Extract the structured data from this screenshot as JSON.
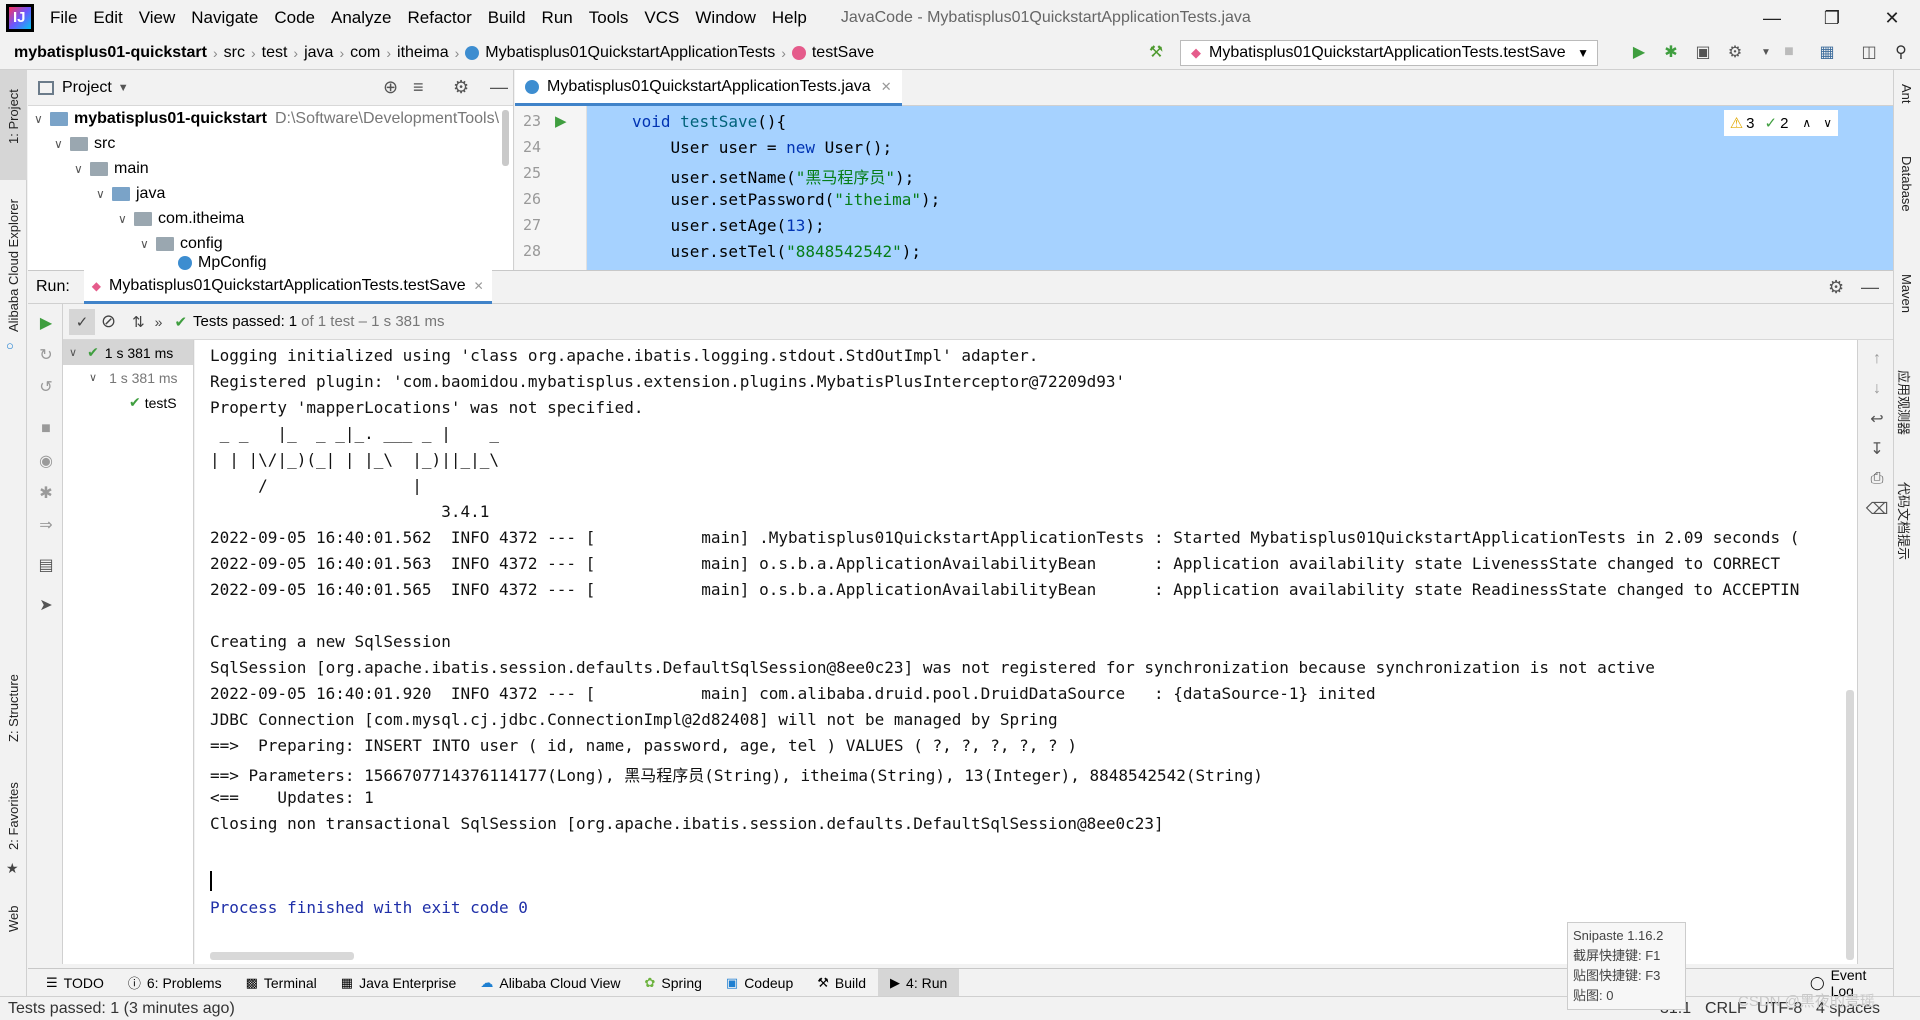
{
  "menubar": {
    "items": [
      "File",
      "Edit",
      "View",
      "Navigate",
      "Code",
      "Analyze",
      "Refactor",
      "Build",
      "Run",
      "Tools",
      "VCS",
      "Window",
      "Help"
    ],
    "title": "JavaCode - Mybatisplus01QuickstartApplicationTests.java"
  },
  "breadcrumb": {
    "items": [
      "mybatisplus01-quickstart",
      "src",
      "test",
      "java",
      "com",
      "itheima",
      "Mybatisplus01QuickstartApplicationTests",
      "testSave"
    ]
  },
  "run_config": "Mybatisplus01QuickstartApplicationTests.testSave",
  "left_strip": {
    "project": "1: Project",
    "alibaba": "Alibaba Cloud Explorer",
    "structure": "Z: Structure",
    "favorites": "2: Favorites",
    "web": "Web"
  },
  "right_strip": {
    "ant": "Ant",
    "database": "Database",
    "maven": "Maven",
    "plugin1": "应用观测器",
    "plugin2": "代码文档提示"
  },
  "project_panel": {
    "title": "Project",
    "root_name": "mybatisplus01-quickstart",
    "root_path": "D:\\Software\\DevelopmentTools\\",
    "tree": [
      "src",
      "main",
      "java",
      "com.itheima",
      "config",
      "MpConfig"
    ]
  },
  "editor": {
    "tab": "Mybatisplus01QuickstartApplicationTests.java",
    "inspect_warnings": "3",
    "inspect_ok": "2",
    "lines": [
      {
        "num": "23",
        "kw": "void ",
        "fn": "testSave",
        "rest": "(){"
      },
      {
        "num": "24",
        "pre": "    User user = ",
        "kw": "new ",
        "rest": "User();"
      },
      {
        "num": "25",
        "pre": "    user.setName(",
        "str": "\"黑马程序员\"",
        "rest": ");"
      },
      {
        "num": "26",
        "pre": "    user.setPassword(",
        "str": "\"itheima\"",
        "rest": ");"
      },
      {
        "num": "27",
        "pre": "    user.setAge(",
        "num_lit": "13",
        "rest": ");"
      },
      {
        "num": "28",
        "pre": "    user.setTel(",
        "str": "\"8848542542\"",
        "rest": ");"
      }
    ]
  },
  "run_panel": {
    "label": "Run:",
    "tab": "Mybatisplus01QuickstartApplicationTests.testSave",
    "status_bold": "Tests passed:",
    "status_count": "1",
    "status_rest": "of 1 test – 1 s 381 ms",
    "tree": [
      {
        "label": "1 s 381 ms"
      },
      {
        "label": "1 s 381 ms"
      },
      {
        "label": "testS"
      }
    ]
  },
  "console": {
    "lines": [
      "Logging initialized using 'class org.apache.ibatis.logging.stdout.StdOutImpl' adapter.",
      "Registered plugin: 'com.baomidou.mybatisplus.extension.plugins.MybatisPlusInterceptor@72209d93'",
      "Property 'mapperLocations' was not specified.",
      " _ _   |_  _ _|_. ___ _ |    _",
      "| | |\\/|_)(_| | |_\\  |_)||_|_\\",
      "     /               |",
      "                        3.4.1",
      "2022-09-05 16:40:01.562  INFO 4372 --- [           main] .Mybatisplus01QuickstartApplicationTests : Started Mybatisplus01QuickstartApplicationTests in 2.09 seconds (",
      "2022-09-05 16:40:01.563  INFO 4372 --- [           main] o.s.b.a.ApplicationAvailabilityBean      : Application availability state LivenessState changed to CORRECT",
      "2022-09-05 16:40:01.565  INFO 4372 --- [           main] o.s.b.a.ApplicationAvailabilityBean      : Application availability state ReadinessState changed to ACCEPTIN",
      "",
      "Creating a new SqlSession",
      "SqlSession [org.apache.ibatis.session.defaults.DefaultSqlSession@8ee0c23] was not registered for synchronization because synchronization is not active",
      "2022-09-05 16:40:01.920  INFO 4372 --- [           main] com.alibaba.druid.pool.DruidDataSource   : {dataSource-1} inited",
      "JDBC Connection [com.mysql.cj.jdbc.ConnectionImpl@2d82408] will not be managed by Spring",
      "==>  Preparing: INSERT INTO user ( id, name, password, age, tel ) VALUES ( ?, ?, ?, ?, ? )",
      "==> Parameters: 1566707714376114177(Long), 黑马程序员(String), itheima(String), 13(Integer), 8848542542(String)",
      "<==    Updates: 1",
      "Closing non transactional SqlSession [org.apache.ibatis.session.defaults.DefaultSqlSession@8ee0c23]",
      "",
      "",
      "Process finished with exit code 0"
    ]
  },
  "bottom_tools": [
    {
      "icon": "list-icon",
      "label": "TODO"
    },
    {
      "icon": "problems-icon",
      "label": "6: Problems"
    },
    {
      "icon": "terminal-icon",
      "label": "Terminal"
    },
    {
      "icon": "enterprise-icon",
      "label": "Java Enterprise"
    },
    {
      "icon": "cloud-icon",
      "label": "Alibaba Cloud View"
    },
    {
      "icon": "spring-icon",
      "label": "Spring"
    },
    {
      "icon": "codeup-icon",
      "label": "Codeup"
    },
    {
      "icon": "hammer-icon",
      "label": "Build"
    },
    {
      "icon": "run-icon",
      "label": "4: Run"
    }
  ],
  "event_log": "Event Log",
  "statusbar": {
    "left": "Tests passed: 1 (3 minutes ago)",
    "position": "31:1",
    "line_sep": "CRLF",
    "encoding": "UTF-8",
    "indent": "4 spaces"
  },
  "snipaste": {
    "title": "Snipaste 1.16.2",
    "line1": "截屏快捷键: F1",
    "line2": "贴图快捷键: F3",
    "line3": "贴图: 0"
  },
  "watermark": "CSDN @黑夜的景瑶"
}
